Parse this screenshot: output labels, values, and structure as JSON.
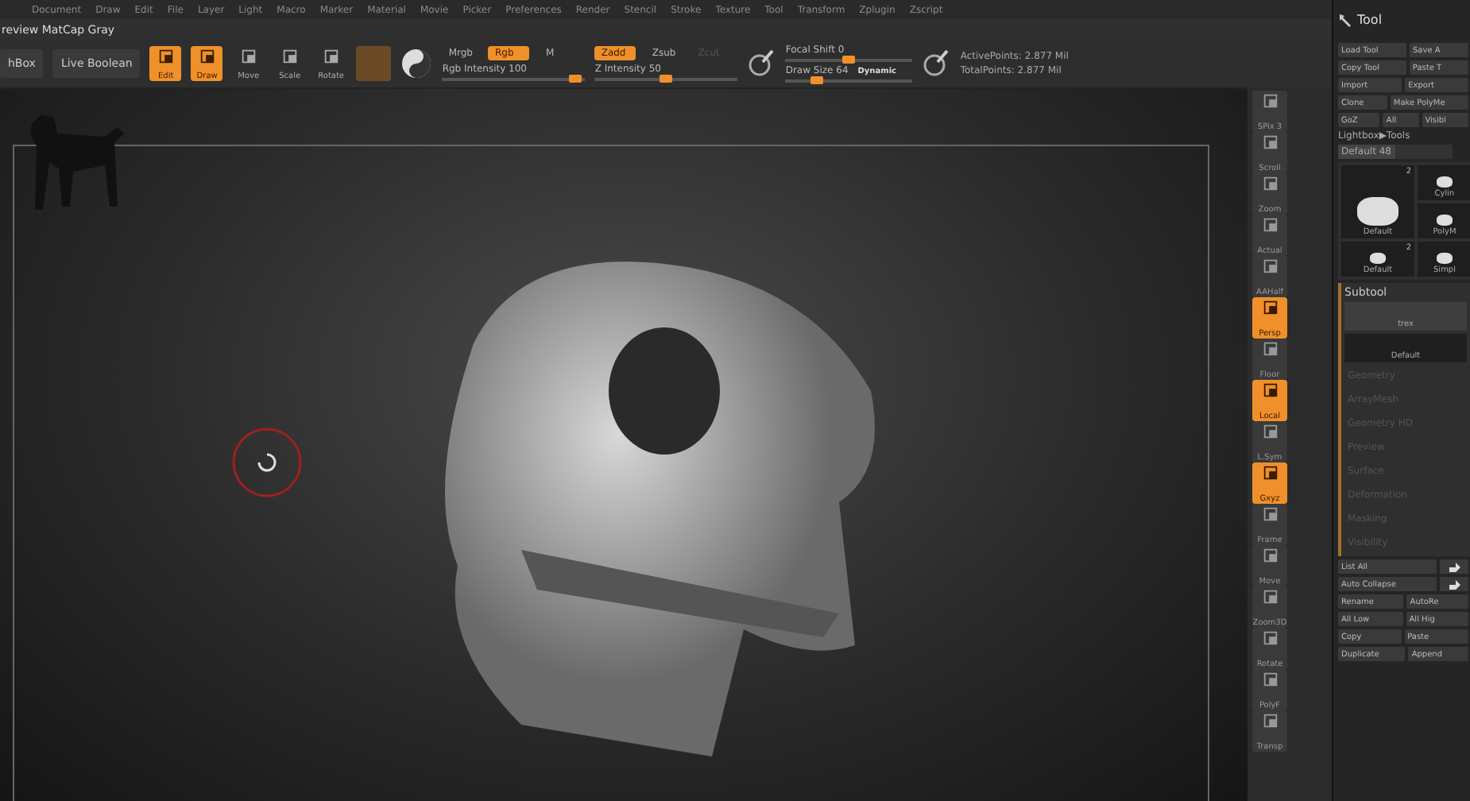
{
  "menu": [
    "Document",
    "Draw",
    "Edit",
    "File",
    "Layer",
    "Light",
    "Macro",
    "Marker",
    "Material",
    "Movie",
    "Picker",
    "Preferences",
    "Render",
    "Stencil",
    "Stroke",
    "Texture",
    "Tool",
    "Transform",
    "Zplugin",
    "Zscript"
  ],
  "document": {
    "title": "review MatCap Gray"
  },
  "toolbar": {
    "left_buttons": [
      "hBox",
      "Live Boolean"
    ],
    "modes": [
      {
        "label": "Edit",
        "selected": true
      },
      {
        "label": "Draw",
        "selected": true
      },
      {
        "label": "Move",
        "selected": false
      },
      {
        "label": "Scale",
        "selected": false
      },
      {
        "label": "Rotate",
        "selected": false
      }
    ],
    "color_modes": [
      {
        "label": "Mrgb",
        "selected": false
      },
      {
        "label": "Rgb",
        "selected": true
      },
      {
        "label": "M",
        "selected": false
      }
    ],
    "depth_modes": [
      {
        "label": "Zadd",
        "selected": true,
        "disabled": false
      },
      {
        "label": "Zsub",
        "selected": false,
        "disabled": false
      },
      {
        "label": "Zcut",
        "selected": false,
        "disabled": true
      }
    ],
    "sliders_a": [
      {
        "label": "Rgb Intensity 100",
        "level": 0.93
      },
      {
        "label": "Z Intensity 50",
        "level": 0.5
      }
    ],
    "sliders_b": [
      {
        "label": "Focal Shift 0",
        "level": 0.5
      },
      {
        "label": "Draw Size 64",
        "level": 0.25
      }
    ],
    "dynamic": "Dynamic",
    "stats": [
      "ActivePoints: 2.877 Mil",
      "TotalPoints: 2.877 Mil"
    ]
  },
  "view_tools": [
    {
      "label": "SPix 3",
      "selected": false
    },
    {
      "label": "Scroll",
      "selected": false
    },
    {
      "label": "Zoom",
      "selected": false
    },
    {
      "label": "Actual",
      "selected": false
    },
    {
      "label": "AAHalf",
      "selected": false
    },
    {
      "label": "Persp",
      "selected": true
    },
    {
      "label": "Floor",
      "selected": false
    },
    {
      "label": "Local",
      "selected": true
    },
    {
      "label": "L.Sym",
      "selected": false
    },
    {
      "label": "Gxyz",
      "selected": true
    },
    {
      "label": "Frame",
      "selected": false
    },
    {
      "label": "Move",
      "selected": false
    },
    {
      "label": "Zoom3D",
      "selected": false
    },
    {
      "label": "Rotate",
      "selected": false
    },
    {
      "label": "PolyF",
      "selected": false
    },
    {
      "label": "Transp",
      "selected": false
    }
  ],
  "tool_palette": {
    "title": "Tool",
    "button_rows": [
      [
        "Load Tool",
        "Save A"
      ],
      [
        "Copy Tool",
        "Paste T"
      ],
      [
        "Import",
        "Export"
      ],
      [
        "Clone",
        "Make PolyMe"
      ],
      [
        "GoZ",
        "All",
        "Visibl"
      ]
    ],
    "lightbox": "Lightbox▶Tools",
    "default_slider": {
      "label": "Default 48",
      "level": 0.5
    },
    "thumbnails": [
      {
        "label": "Default",
        "count": "2"
      },
      {
        "label": "Cylin"
      },
      {
        "label": "PolyM"
      },
      {
        "label": "Default",
        "count": "2"
      },
      {
        "label": "Simpl"
      }
    ],
    "subtool": {
      "title": "Subtool",
      "items": [
        {
          "label": "trex",
          "selected": true
        },
        {
          "label": "Default",
          "selected": false
        }
      ]
    },
    "sections": [
      "Geometry",
      "ArrayMesh",
      "Geometry HD",
      "Preview",
      "Surface",
      "Deformation",
      "Masking",
      "Visibility"
    ],
    "bottom_rows": [
      [
        "List All"
      ],
      [
        "Auto Collapse"
      ],
      [
        "Rename",
        "AutoRe"
      ],
      [
        "All Low",
        "All Hig"
      ],
      [
        "Copy",
        "Paste"
      ],
      [
        "Duplicate",
        "Append"
      ]
    ]
  }
}
